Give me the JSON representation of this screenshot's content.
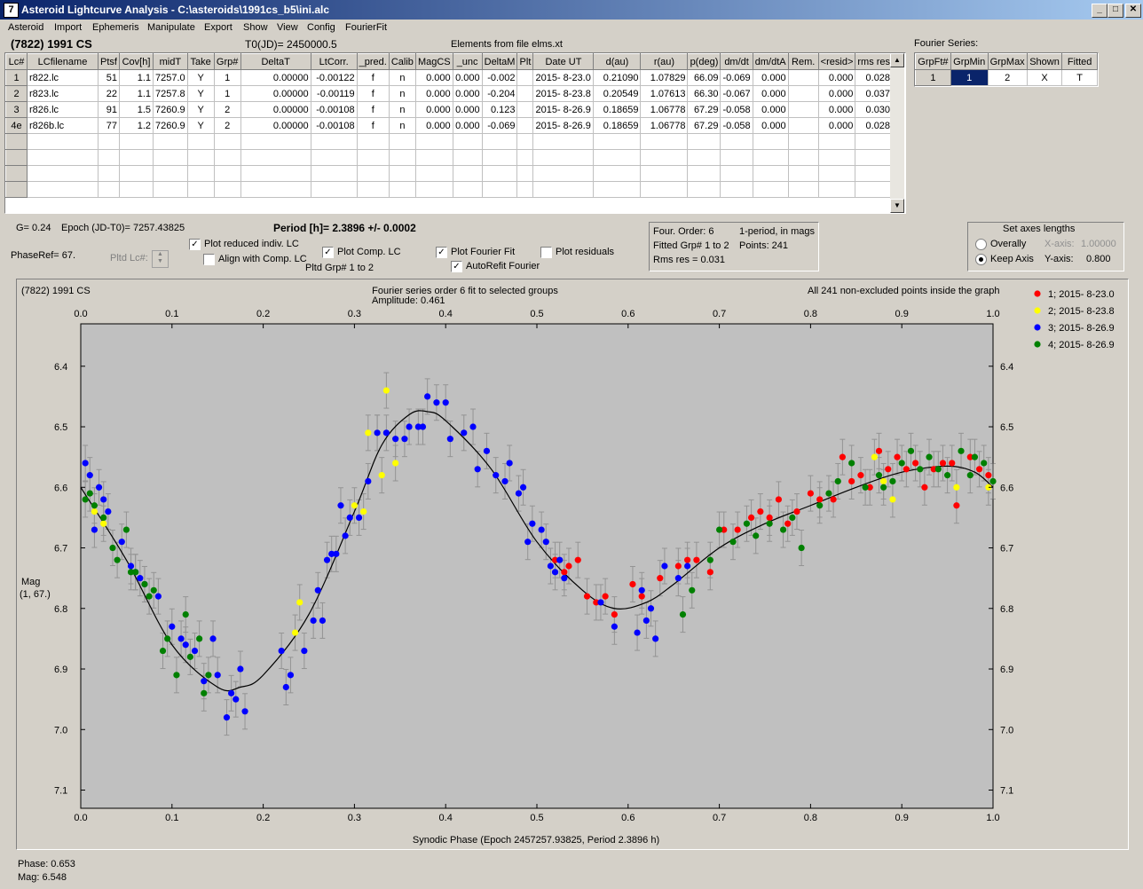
{
  "window": {
    "title": "Asteroid Lightcurve Analysis - C:\\asteroids\\1991cs_b5\\ini.alc",
    "icon": "app-icon",
    "controls": [
      "_",
      "□",
      "✕"
    ]
  },
  "menu": [
    "Asteroid",
    "Import",
    "Ephemeris",
    "Manipulate",
    "Export",
    "Show",
    "View",
    "Config",
    "FourierFit"
  ],
  "header": {
    "asteroid": "(7822) 1991 CS",
    "t0": "T0(JD)= 2450000.5",
    "elements": "Elements from file elms.xt",
    "fourier_label": "Fourier Series:"
  },
  "lc_table": {
    "columns": [
      "Lc#",
      "LCfilename",
      "Ptsf",
      "Cov[h]",
      "midT",
      "Take",
      "Grp#",
      "DeltaT",
      "LtCorr.",
      "_pred.",
      "Calib",
      "MagCS",
      "_unc",
      "DeltaM",
      "Plt",
      "Date UT",
      "d(au)",
      "r(au)",
      "p(deg)",
      "dm/dt",
      "dm/dtA",
      "Rem.",
      "<resid>",
      "rms res"
    ],
    "rows": [
      [
        "1",
        "r822.lc",
        "51",
        "1.1",
        "7257.0",
        "Y",
        "1",
        "0.00000",
        "-0.00122",
        "f",
        "n",
        "0.000",
        "0.000",
        "-0.002",
        "",
        "2015- 8-23.0",
        "0.21090",
        "1.07829",
        "66.09",
        "-0.069",
        "0.000",
        "",
        "0.000",
        "0.028"
      ],
      [
        "2",
        "r823.lc",
        "22",
        "1.1",
        "7257.8",
        "Y",
        "1",
        "0.00000",
        "-0.00119",
        "f",
        "n",
        "0.000",
        "0.000",
        "-0.204",
        "",
        "2015- 8-23.8",
        "0.20549",
        "1.07613",
        "66.30",
        "-0.067",
        "0.000",
        "",
        "0.000",
        "0.037"
      ],
      [
        "3",
        "r826.lc",
        "91",
        "1.5",
        "7260.9",
        "Y",
        "2",
        "0.00000",
        "-0.00108",
        "f",
        "n",
        "0.000",
        "0.000",
        "0.123",
        "",
        "2015- 8-26.9",
        "0.18659",
        "1.06778",
        "67.29",
        "-0.058",
        "0.000",
        "",
        "0.000",
        "0.030"
      ],
      [
        "4e",
        "r826b.lc",
        "77",
        "1.2",
        "7260.9",
        "Y",
        "2",
        "0.00000",
        "-0.00108",
        "f",
        "n",
        "0.000",
        "0.000",
        "-0.069",
        "",
        "2015- 8-26.9",
        "0.18659",
        "1.06778",
        "67.29",
        "-0.058",
        "0.000",
        "",
        "0.000",
        "0.028"
      ]
    ]
  },
  "fourier_table": {
    "columns": [
      "GrpFt#",
      "GrpMin",
      "GrpMax",
      "Shown",
      "Fitted"
    ],
    "rows": [
      [
        "1",
        "1",
        "2",
        "X",
        "T"
      ]
    ]
  },
  "info": {
    "g": "G= 0.24",
    "epoch": "Epoch (JD-T0)= 7257.43825",
    "period": "Period [h]= 2.3896 +/- 0.0002",
    "phaseref": "PhaseRef= 67.",
    "pltd_lc": "Pltd Lc#:",
    "pltd_grp": "Pltd Grp#  1   to   2",
    "four_order": "Four. Order:  6",
    "one_period": "1-period, in mags",
    "fitted_grp": "Fitted Grp# 1 to 2",
    "points": "Points: 241",
    "rms": "Rms res     = 0.031"
  },
  "checkboxes": {
    "reduced": {
      "label": "Plot reduced indiv. LC",
      "checked": true
    },
    "align": {
      "label": "Align with Comp. LC",
      "checked": false
    },
    "comp": {
      "label": "Plot Comp. LC",
      "checked": true
    },
    "fourier": {
      "label": "Plot Fourier Fit",
      "checked": true
    },
    "residuals": {
      "label": "Plot residuals",
      "checked": false
    },
    "autorefit": {
      "label": "AutoRefit Fourier",
      "checked": true
    }
  },
  "axes_box": {
    "title": "Set axes lengths",
    "overally": "Overally",
    "keep": "Keep Axis",
    "xaxis_label": "X-axis:",
    "xaxis_value": "1.00000",
    "yaxis_label": "Y-axis:",
    "yaxis_value": "0.800"
  },
  "plot_text": {
    "object": "(7822) 1991 CS",
    "fit_title": "Fourier series order 6 fit to selected groups",
    "amplitude": "Amplitude: 0.461",
    "note": "All 241 non-excluded points inside the graph",
    "ylabel1": "Mag",
    "ylabel2": "(1, 67.)"
  },
  "status": {
    "phase": "Phase:  0.653",
    "mag": "Mag:     6.548"
  },
  "chart_data": {
    "type": "scatter",
    "xlabel": "Synodic Phase (Epoch 2457257.93825, Period 2.3896 h)",
    "ylabel": "Mag",
    "xlim": [
      0,
      1
    ],
    "ylim": [
      6.33,
      7.13
    ],
    "y_inverted": true,
    "x_ticks": [
      "0.0",
      "0.1",
      "0.2",
      "0.3",
      "0.4",
      "0.5",
      "0.6",
      "0.7",
      "0.8",
      "0.9",
      "1.0"
    ],
    "y_ticks": [
      "6.4",
      "6.5",
      "6.6",
      "6.7",
      "6.8",
      "6.9",
      "7.0",
      "7.1"
    ],
    "legend_position": "right",
    "series": [
      {
        "name": "1; 2015- 8-23.0",
        "color": "#ff0000",
        "points": [
          [
            0.52,
            6.72
          ],
          [
            0.53,
            6.74
          ],
          [
            0.535,
            6.73
          ],
          [
            0.545,
            6.72
          ],
          [
            0.555,
            6.78
          ],
          [
            0.565,
            6.79
          ],
          [
            0.575,
            6.78
          ],
          [
            0.585,
            6.81
          ],
          [
            0.605,
            6.76
          ],
          [
            0.615,
            6.78
          ],
          [
            0.635,
            6.75
          ],
          [
            0.655,
            6.73
          ],
          [
            0.665,
            6.72
          ],
          [
            0.675,
            6.72
          ],
          [
            0.69,
            6.74
          ],
          [
            0.705,
            6.67
          ],
          [
            0.72,
            6.67
          ],
          [
            0.735,
            6.65
          ],
          [
            0.745,
            6.64
          ],
          [
            0.755,
            6.65
          ],
          [
            0.765,
            6.62
          ],
          [
            0.775,
            6.66
          ],
          [
            0.785,
            6.64
          ],
          [
            0.8,
            6.61
          ],
          [
            0.81,
            6.62
          ],
          [
            0.825,
            6.62
          ],
          [
            0.835,
            6.55
          ],
          [
            0.845,
            6.59
          ],
          [
            0.855,
            6.58
          ],
          [
            0.865,
            6.6
          ],
          [
            0.875,
            6.54
          ],
          [
            0.885,
            6.57
          ],
          [
            0.895,
            6.55
          ],
          [
            0.905,
            6.57
          ],
          [
            0.915,
            6.56
          ],
          [
            0.925,
            6.6
          ],
          [
            0.935,
            6.57
          ],
          [
            0.945,
            6.56
          ],
          [
            0.955,
            6.56
          ],
          [
            0.96,
            6.63
          ],
          [
            0.975,
            6.55
          ],
          [
            0.985,
            6.57
          ],
          [
            0.995,
            6.58
          ]
        ]
      },
      {
        "name": "2; 2015- 8-23.8",
        "color": "#ffff00",
        "points": [
          [
            0.015,
            6.64
          ],
          [
            0.025,
            6.66
          ],
          [
            0.235,
            6.84
          ],
          [
            0.24,
            6.79
          ],
          [
            0.3,
            6.63
          ],
          [
            0.31,
            6.64
          ],
          [
            0.315,
            6.51
          ],
          [
            0.325,
            6.51
          ],
          [
            0.33,
            6.58
          ],
          [
            0.335,
            6.44
          ],
          [
            0.345,
            6.56
          ],
          [
            0.87,
            6.55
          ],
          [
            0.88,
            6.59
          ],
          [
            0.89,
            6.62
          ],
          [
            0.96,
            6.6
          ],
          [
            0.995,
            6.6
          ]
        ]
      },
      {
        "name": "3; 2015- 8-26.9",
        "color": "#0000ff",
        "points": [
          [
            0.005,
            6.56
          ],
          [
            0.01,
            6.58
          ],
          [
            0.015,
            6.67
          ],
          [
            0.02,
            6.6
          ],
          [
            0.025,
            6.62
          ],
          [
            0.03,
            6.64
          ],
          [
            0.045,
            6.69
          ],
          [
            0.055,
            6.73
          ],
          [
            0.06,
            6.74
          ],
          [
            0.065,
            6.75
          ],
          [
            0.07,
            6.76
          ],
          [
            0.085,
            6.78
          ],
          [
            0.1,
            6.83
          ],
          [
            0.11,
            6.85
          ],
          [
            0.115,
            6.86
          ],
          [
            0.125,
            6.87
          ],
          [
            0.135,
            6.92
          ],
          [
            0.145,
            6.85
          ],
          [
            0.15,
            6.91
          ],
          [
            0.16,
            6.98
          ],
          [
            0.165,
            6.94
          ],
          [
            0.17,
            6.95
          ],
          [
            0.175,
            6.9
          ],
          [
            0.18,
            6.97
          ],
          [
            0.22,
            6.87
          ],
          [
            0.225,
            6.93
          ],
          [
            0.23,
            6.91
          ],
          [
            0.245,
            6.87
          ],
          [
            0.255,
            6.82
          ],
          [
            0.26,
            6.77
          ],
          [
            0.265,
            6.82
          ],
          [
            0.27,
            6.72
          ],
          [
            0.275,
            6.71
          ],
          [
            0.28,
            6.71
          ],
          [
            0.285,
            6.63
          ],
          [
            0.29,
            6.68
          ],
          [
            0.295,
            6.65
          ],
          [
            0.305,
            6.65
          ],
          [
            0.315,
            6.59
          ],
          [
            0.325,
            6.51
          ],
          [
            0.335,
            6.51
          ],
          [
            0.345,
            6.52
          ],
          [
            0.355,
            6.52
          ],
          [
            0.36,
            6.5
          ],
          [
            0.37,
            6.5
          ],
          [
            0.375,
            6.5
          ],
          [
            0.38,
            6.45
          ],
          [
            0.39,
            6.46
          ],
          [
            0.4,
            6.46
          ],
          [
            0.405,
            6.52
          ],
          [
            0.42,
            6.51
          ],
          [
            0.43,
            6.5
          ],
          [
            0.435,
            6.57
          ],
          [
            0.445,
            6.54
          ],
          [
            0.455,
            6.58
          ],
          [
            0.465,
            6.59
          ],
          [
            0.47,
            6.56
          ],
          [
            0.48,
            6.61
          ],
          [
            0.485,
            6.6
          ],
          [
            0.49,
            6.69
          ],
          [
            0.495,
            6.66
          ],
          [
            0.505,
            6.67
          ],
          [
            0.51,
            6.69
          ],
          [
            0.515,
            6.73
          ],
          [
            0.52,
            6.74
          ],
          [
            0.525,
            6.72
          ],
          [
            0.53,
            6.75
          ],
          [
            0.57,
            6.79
          ],
          [
            0.585,
            6.83
          ],
          [
            0.61,
            6.84
          ],
          [
            0.615,
            6.77
          ],
          [
            0.62,
            6.82
          ],
          [
            0.625,
            6.8
          ],
          [
            0.63,
            6.85
          ],
          [
            0.64,
            6.73
          ],
          [
            0.655,
            6.75
          ],
          [
            0.665,
            6.73
          ]
        ]
      },
      {
        "name": "4; 2015- 8-26.9",
        "color": "#008000",
        "points": [
          [
            0.005,
            6.62
          ],
          [
            0.01,
            6.61
          ],
          [
            0.015,
            6.63
          ],
          [
            0.025,
            6.65
          ],
          [
            0.035,
            6.7
          ],
          [
            0.04,
            6.72
          ],
          [
            0.05,
            6.67
          ],
          [
            0.055,
            6.74
          ],
          [
            0.06,
            6.74
          ],
          [
            0.07,
            6.76
          ],
          [
            0.075,
            6.78
          ],
          [
            0.08,
            6.77
          ],
          [
            0.09,
            6.87
          ],
          [
            0.095,
            6.85
          ],
          [
            0.105,
            6.91
          ],
          [
            0.115,
            6.81
          ],
          [
            0.12,
            6.88
          ],
          [
            0.13,
            6.85
          ],
          [
            0.14,
            6.91
          ],
          [
            0.135,
            6.94
          ],
          [
            0.66,
            6.81
          ],
          [
            0.67,
            6.77
          ],
          [
            0.69,
            6.72
          ],
          [
            0.7,
            6.67
          ],
          [
            0.715,
            6.69
          ],
          [
            0.73,
            6.66
          ],
          [
            0.74,
            6.68
          ],
          [
            0.755,
            6.66
          ],
          [
            0.77,
            6.67
          ],
          [
            0.78,
            6.65
          ],
          [
            0.79,
            6.7
          ],
          [
            0.81,
            6.63
          ],
          [
            0.82,
            6.61
          ],
          [
            0.83,
            6.59
          ],
          [
            0.845,
            6.56
          ],
          [
            0.86,
            6.6
          ],
          [
            0.875,
            6.58
          ],
          [
            0.88,
            6.6
          ],
          [
            0.89,
            6.59
          ],
          [
            0.9,
            6.56
          ],
          [
            0.91,
            6.54
          ],
          [
            0.92,
            6.57
          ],
          [
            0.93,
            6.55
          ],
          [
            0.94,
            6.57
          ],
          [
            0.95,
            6.58
          ],
          [
            0.965,
            6.54
          ],
          [
            0.975,
            6.58
          ],
          [
            0.98,
            6.55
          ],
          [
            0.99,
            6.56
          ],
          [
            1.0,
            6.59
          ]
        ]
      }
    ],
    "fit_curve": [
      [
        0,
        6.6
      ],
      [
        0.05,
        6.72
      ],
      [
        0.1,
        6.86
      ],
      [
        0.15,
        6.93
      ],
      [
        0.175,
        6.93
      ],
      [
        0.2,
        6.91
      ],
      [
        0.25,
        6.81
      ],
      [
        0.3,
        6.64
      ],
      [
        0.33,
        6.53
      ],
      [
        0.36,
        6.48
      ],
      [
        0.38,
        6.475
      ],
      [
        0.4,
        6.49
      ],
      [
        0.45,
        6.57
      ],
      [
        0.5,
        6.69
      ],
      [
        0.55,
        6.77
      ],
      [
        0.585,
        6.8
      ],
      [
        0.62,
        6.79
      ],
      [
        0.65,
        6.76
      ],
      [
        0.7,
        6.7
      ],
      [
        0.75,
        6.66
      ],
      [
        0.8,
        6.63
      ],
      [
        0.85,
        6.6
      ],
      [
        0.9,
        6.575
      ],
      [
        0.95,
        6.565
      ],
      [
        0.98,
        6.575
      ],
      [
        1.0,
        6.6
      ]
    ]
  }
}
